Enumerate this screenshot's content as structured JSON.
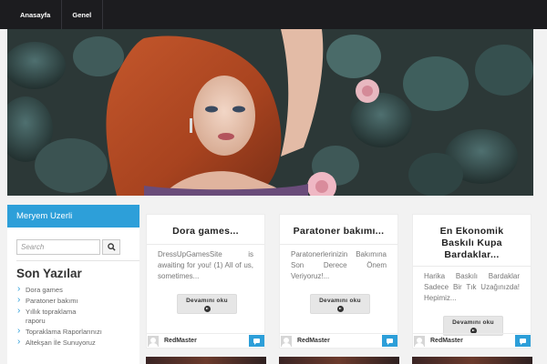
{
  "nav": {
    "items": [
      {
        "label": "Anasayfa"
      },
      {
        "label": "Genel"
      }
    ]
  },
  "hero": {
    "image_desc": "woman-with-red-hair-and-leaves"
  },
  "sidebar": {
    "widget_title": "Meryem Uzerli",
    "search_placeholder": "Search",
    "recent_title": "Son Yazılar",
    "recent_posts": [
      {
        "label": "Dora games"
      },
      {
        "label": "Paratoner bakımı"
      },
      {
        "label": "Yıllık topraklama raporu"
      },
      {
        "label": "Topraklama Raporlarınızı"
      },
      {
        "label": "Altekşan İle Sunuyoruz"
      }
    ]
  },
  "posts": [
    {
      "title": "Dora games...",
      "excerpt": "DressUpGamesSite is awaiting for you! (1) All of us, sometimes...",
      "read_more": "Devamını oku",
      "author": "RedMaster"
    },
    {
      "title": "Paratoner bakımı...",
      "excerpt": "Paratonerlerinizin Bakımına Son Derece Önem Veriyoruz!...",
      "read_more": "Devamını oku",
      "author": "RedMaster"
    },
    {
      "title": "En Ekonomik Baskılı Kupa Bardaklar...",
      "excerpt": "Harika Baskılı Bardaklar Sadece Bir Tık Uzağınızda! Hepimiz...",
      "read_more": "Devamını oku",
      "author": "RedMaster"
    }
  ],
  "colors": {
    "accent": "#2d9fd9",
    "nav_bg": "#1c1c1f"
  }
}
